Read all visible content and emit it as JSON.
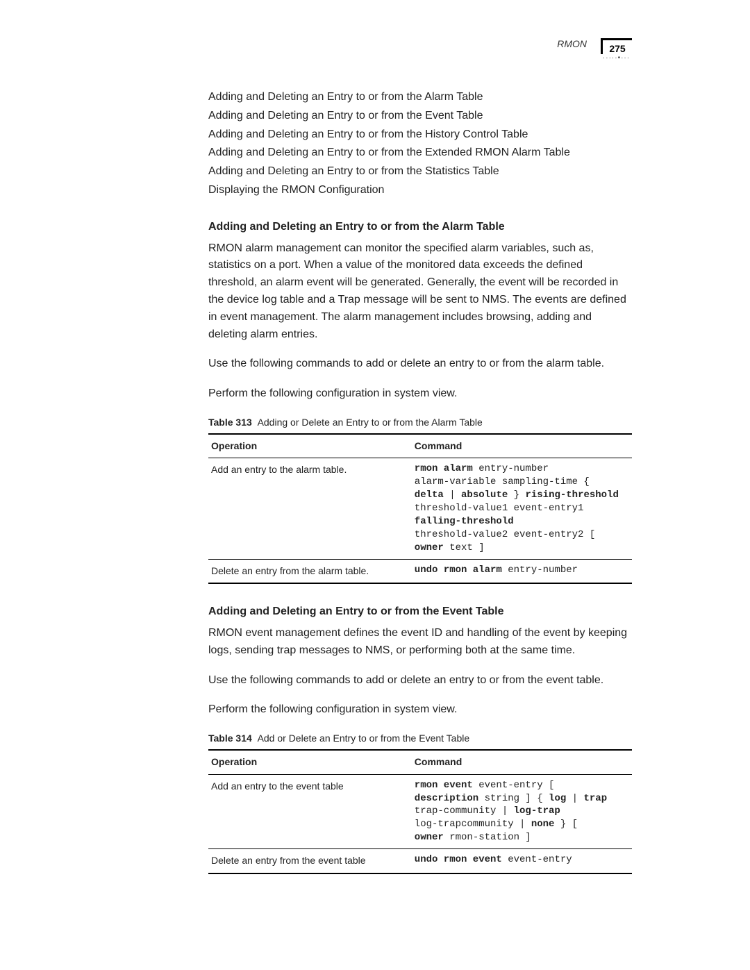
{
  "header": {
    "section": "RMON",
    "page": "275"
  },
  "toc": [
    "Adding and Deleting an Entry to or from the Alarm Table",
    "Adding and Deleting an Entry to or from the Event Table",
    "Adding and Deleting an Entry to or from the History Control Table",
    "Adding and Deleting an Entry to or from the Extended RMON Alarm Table",
    "Adding and Deleting an Entry to or from the Statistics Table",
    "Displaying the RMON Configuration"
  ],
  "section1": {
    "heading": "Adding and Deleting an Entry to or from the Alarm Table",
    "para1": "RMON alarm management can monitor the specified alarm variables, such as, statistics on a port. When a value of the monitored data exceeds the defined threshold, an alarm event will be generated. Generally, the event will be recorded in the device log table and a Trap message will be sent to NMS. The events are defined in event management. The alarm management includes browsing, adding and deleting alarm entries.",
    "para2": "Use the following commands to add or delete an entry to or from the alarm table.",
    "para3": "Perform the following configuration in system view.",
    "table_caption_label": "Table 313",
    "table_caption_text": "Adding or Delete an Entry to or from the Alarm Table",
    "th_op": "Operation",
    "th_cmd": "Command",
    "row1_op": "Add an entry to the alarm table.",
    "row1_cmd_l1a": "rmon alarm",
    "row1_cmd_l1b": " entry-number",
    "row1_cmd_l2": "alarm-variable sampling-time {",
    "row1_cmd_l3a": "delta",
    "row1_cmd_l3b": " | ",
    "row1_cmd_l3c": "absolute",
    "row1_cmd_l3d": " } ",
    "row1_cmd_l3e": "rising-threshold",
    "row1_cmd_l4": "threshold-value1 event-entry1",
    "row1_cmd_l5": "falling-threshold",
    "row1_cmd_l6": "threshold-value2 event-entry2 [",
    "row1_cmd_l7a": "owner",
    "row1_cmd_l7b": " text ]",
    "row2_op": "Delete an entry from the alarm table.",
    "row2_cmd_a": "undo rmon alarm",
    "row2_cmd_b": " entry-number"
  },
  "section2": {
    "heading": "Adding and Deleting an Entry to or from the Event Table",
    "para1": "RMON event management defines the event ID and handling of the event by keeping logs, sending trap messages to NMS, or performing both at the same time.",
    "para2": "Use the following commands to add or delete an entry to or from the event table.",
    "para3": "Perform the following configuration in system view.",
    "table_caption_label": "Table 314",
    "table_caption_text": "Add or Delete an Entry to or from the Event Table",
    "th_op": "Operation",
    "th_cmd": "Command",
    "row1_op": "Add an entry to the event table",
    "row1_cmd_l1a": "rmon event",
    "row1_cmd_l1b": " event-entry [",
    "row1_cmd_l2a": "description",
    "row1_cmd_l2b": " string ] { ",
    "row1_cmd_l2c": "log",
    "row1_cmd_l2d": " | ",
    "row1_cmd_l2e": "trap",
    "row1_cmd_l3a": "trap-community | ",
    "row1_cmd_l3b": "log-trap",
    "row1_cmd_l4a": "log-trapcommunity | ",
    "row1_cmd_l4b": "none",
    "row1_cmd_l4c": " } [",
    "row1_cmd_l5a": "owner",
    "row1_cmd_l5b": " rmon-station ]",
    "row2_op": "Delete an entry from the event table",
    "row2_cmd_a": "undo rmon event",
    "row2_cmd_b": " event-entry"
  }
}
